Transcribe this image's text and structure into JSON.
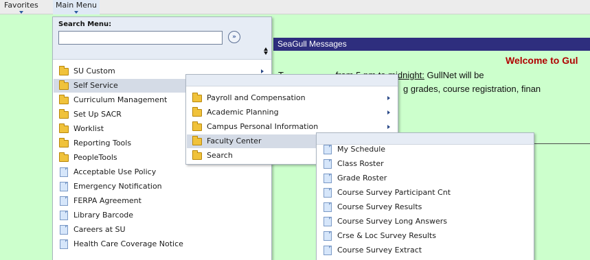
{
  "menubar": {
    "favorites": "Favorites",
    "main_menu": "Main Menu"
  },
  "background": {
    "banner_title": "SeaGull Messages",
    "welcome": "Welcome to Gul",
    "message_line1_prefix": "T",
    "message_line1_underlined": "                     from 5 pm to midnight:",
    "message_line1_suffix": " GullNet will be",
    "message_line2": "g grades, course registration, finan"
  },
  "search": {
    "label": "Search Menu:",
    "value": "",
    "go_icon": "double-chevron-right-icon",
    "sort_icon": "sort-up-down-icon"
  },
  "main_menu_items": [
    {
      "label": "SU Custom",
      "icon": "folder",
      "has_submenu": true
    },
    {
      "label": "Self Service",
      "icon": "folder",
      "has_submenu": true,
      "selected": true
    },
    {
      "label": "Curriculum Management",
      "icon": "folder",
      "has_submenu": true
    },
    {
      "label": "Set Up SACR",
      "icon": "folder",
      "has_submenu": true
    },
    {
      "label": "Worklist",
      "icon": "folder",
      "has_submenu": true
    },
    {
      "label": "Reporting Tools",
      "icon": "folder",
      "has_submenu": true
    },
    {
      "label": "PeopleTools",
      "icon": "folder",
      "has_submenu": true
    },
    {
      "label": "Acceptable Use Policy",
      "icon": "document",
      "has_submenu": false
    },
    {
      "label": "Emergency Notification",
      "icon": "document",
      "has_submenu": false
    },
    {
      "label": "FERPA Agreement",
      "icon": "document",
      "has_submenu": false
    },
    {
      "label": "Library Barcode",
      "icon": "document",
      "has_submenu": false
    },
    {
      "label": "Careers at SU",
      "icon": "document",
      "has_submenu": false
    },
    {
      "label": "Health Care Coverage Notice",
      "icon": "document",
      "has_submenu": false
    }
  ],
  "self_service_items": [
    {
      "label": "Payroll and Compensation",
      "icon": "folder",
      "has_submenu": true
    },
    {
      "label": "Academic Planning",
      "icon": "folder",
      "has_submenu": true
    },
    {
      "label": "Campus Personal Information",
      "icon": "folder",
      "has_submenu": true
    },
    {
      "label": "Faculty Center",
      "icon": "folder",
      "has_submenu": true,
      "selected": true
    },
    {
      "label": "Search",
      "icon": "folder",
      "has_submenu": true
    }
  ],
  "faculty_center_items": [
    {
      "label": "My Schedule",
      "icon": "document"
    },
    {
      "label": "Class Roster",
      "icon": "document"
    },
    {
      "label": "Grade Roster",
      "icon": "document"
    },
    {
      "label": "Course Survey Participant Cnt",
      "icon": "document"
    },
    {
      "label": "Course Survey Results",
      "icon": "document"
    },
    {
      "label": "Course Survey Long Answers",
      "icon": "document"
    },
    {
      "label": "Crse & Loc Survey Results",
      "icon": "document"
    },
    {
      "label": "Course Survey Extract",
      "icon": "document"
    }
  ]
}
